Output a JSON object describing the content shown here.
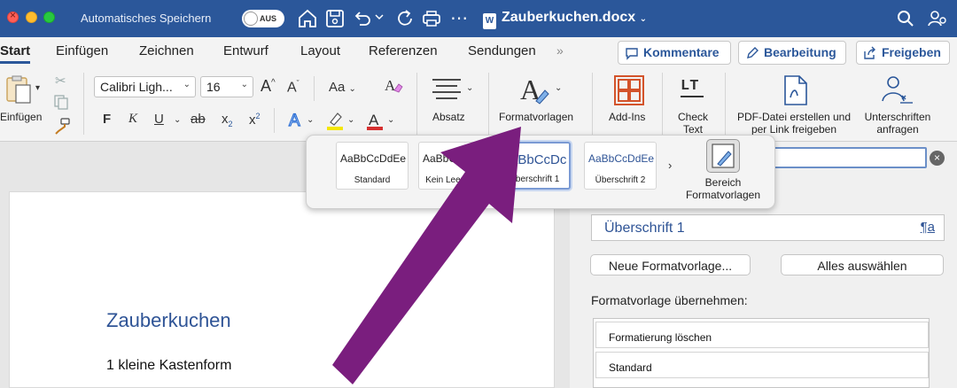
{
  "titlebar": {
    "autosave_label": "Automatisches Speichern",
    "toggle_state": "AUS",
    "doc_name": "Zauberkuchen.docx",
    "doc_icon": "W"
  },
  "tabs": {
    "items": [
      "Start",
      "Einfügen",
      "Zeichnen",
      "Entwurf",
      "Layout",
      "Referenzen",
      "Sendungen"
    ],
    "more": "»",
    "comments_label": "Kommentare",
    "editing_label": "Bearbeitung",
    "share_label": "Freigeben"
  },
  "ribbon": {
    "paste_label": "Einfügen",
    "font_name": "Calibri Ligh...",
    "font_size": "16",
    "bold": "F",
    "italic": "K",
    "underline": "U",
    "strike": "ab",
    "subscript": "x",
    "superscript": "x",
    "font_grow": "A",
    "font_shrink": "A",
    "change_case": "Aa",
    "paragraph_label": "Absatz",
    "styles_label": "Formatvorlagen",
    "addins_label": "Add-Ins",
    "check_text_label": "Check Text",
    "lt_logo": "LT",
    "pdf_label": "PDF-Datei erstellen und per Link freigeben",
    "signature_label": "Unterschriften anfragen"
  },
  "gallery": {
    "cards": [
      {
        "preview": "AaBbCcDdEe",
        "name": "Standard"
      },
      {
        "preview": "AaBbCcDdEe",
        "name": "Kein Leerraum"
      },
      {
        "preview": "AaBbCcDc",
        "name": "Überschrift 1"
      },
      {
        "preview": "AaBbCcDdEe",
        "name": "Überschrift 2"
      }
    ],
    "next": "›",
    "pane_label": "Bereich Formatvorlagen"
  },
  "pane": {
    "current_style": "Überschrift 1",
    "para_mark": "¶a",
    "new_style_button": "Neue Formatvorlage...",
    "select_all_button": "Alles auswählen",
    "apply_label": "Formatvorlage übernehmen:",
    "styles": [
      "Formatierung löschen",
      "Standard"
    ]
  },
  "document": {
    "heading": "Zauberkuchen",
    "line1": "1 kleine Kastenform"
  },
  "colors": {
    "title_blue": "#2b579a",
    "heading_blue": "#2f5496",
    "arrow_purple": "#7a1e7e"
  }
}
